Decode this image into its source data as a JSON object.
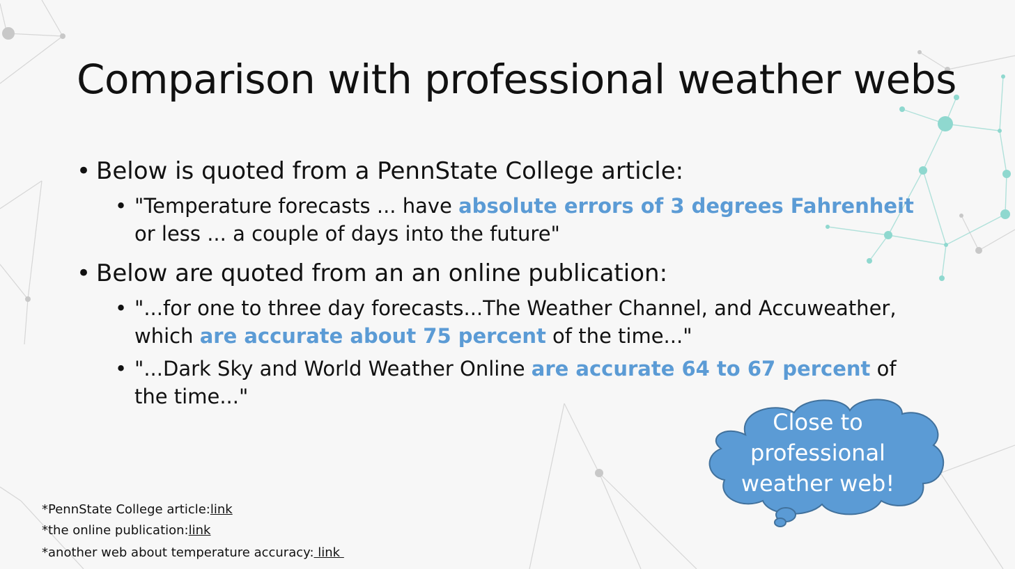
{
  "slide": {
    "title": "Comparison with professional weather webs",
    "bullets": [
      {
        "text": "Below is quoted from a PennState College article:",
        "sub": [
          {
            "before": "\"Temperature forecasts ... have ",
            "highlight": "absolute errors of 3 degrees Fahrenheit",
            "after": " or less ... a couple of days into the future\""
          }
        ]
      },
      {
        "text": "Below are quoted from an an online publication:",
        "sub": [
          {
            "before": "\"...for one to three day forecasts...The Weather Channel, and Accuweather, which ",
            "highlight": "are accurate about 75 percent",
            "after": " of the time...\""
          },
          {
            "before": "\"...Dark Sky and World Weather Online ",
            "highlight": "are accurate 64 to 67 percent",
            "after": " of the time...\""
          }
        ]
      }
    ],
    "bullet_symbol": "•",
    "callout": "Close to professional weather web!",
    "footnotes": [
      {
        "label": "*PennState College article:",
        "link": "link"
      },
      {
        "label": "*the online publication:",
        "link": "link"
      },
      {
        "label": "*another web about temperature accuracy:",
        "link": " link "
      }
    ]
  },
  "colors": {
    "highlight": "#5b9bd5",
    "callout_fill": "#5b9bd5",
    "callout_stroke": "#41719c",
    "network_gray": "#cfcfcf",
    "network_teal": "#8fd8cf"
  }
}
